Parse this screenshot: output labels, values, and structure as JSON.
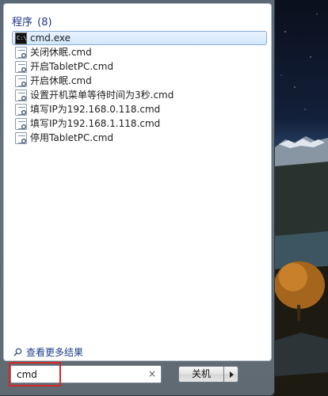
{
  "start_menu": {
    "group_header": {
      "title": "程序",
      "count": "(8)"
    },
    "results": [
      {
        "label": "cmd.exe",
        "icon": "cmd-icon",
        "selected": true
      },
      {
        "label": "关闭休眠.cmd",
        "icon": "script-icon"
      },
      {
        "label": "开启TabletPC.cmd",
        "icon": "script-icon"
      },
      {
        "label": "开启休眠.cmd",
        "icon": "script-icon"
      },
      {
        "label": "设置开机菜单等待时间为3秒.cmd",
        "icon": "script-icon"
      },
      {
        "label": "填写IP为192.168.0.118.cmd",
        "icon": "script-icon"
      },
      {
        "label": "填写IP为192.168.1.118.cmd",
        "icon": "script-icon"
      },
      {
        "label": "停用TabletPC.cmd",
        "icon": "script-icon"
      }
    ],
    "see_more": {
      "label": "查看更多结果",
      "icon": "search-icon"
    },
    "search": {
      "value": "cmd",
      "clear_symbol": "×"
    },
    "shutdown": {
      "label": "关机",
      "arrow_icon": "chevron-right-icon"
    }
  },
  "colors": {
    "group_header": "#1e3287",
    "selection_fill": "#d2e6fc",
    "selection_border": "#84acdd",
    "highlight_box": "#d42828",
    "link": "#1a3c8c"
  }
}
